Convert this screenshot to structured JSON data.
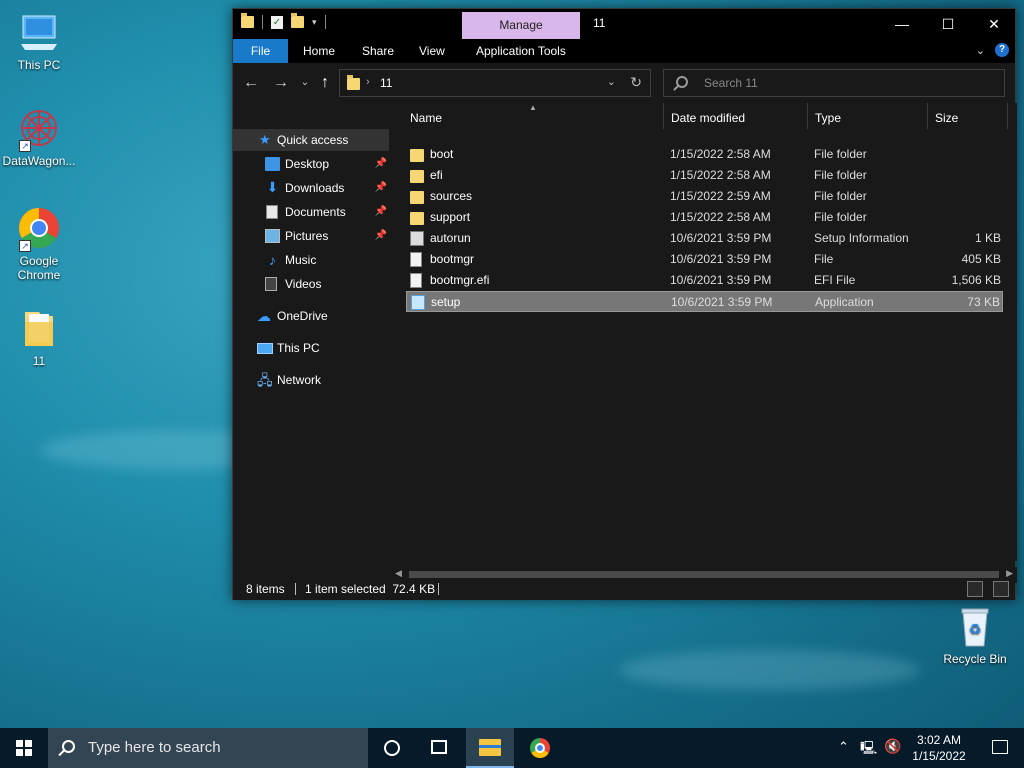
{
  "desktop": {
    "icons": [
      {
        "label": "This PC"
      },
      {
        "label": "DataWagon..."
      },
      {
        "label": "Google Chrome"
      },
      {
        "label": "11"
      }
    ],
    "recycle_bin": "Recycle Bin"
  },
  "window": {
    "title": "11",
    "manage_tab": "Manage",
    "ribbon_tabs": [
      "File",
      "Home",
      "Share",
      "View",
      "Application Tools"
    ],
    "address": {
      "path": "11"
    },
    "search": {
      "placeholder": "Search 11"
    },
    "nav_pane": [
      {
        "label": "Quick access",
        "icon": "star-icon"
      },
      {
        "label": "Desktop",
        "icon": "desktop-icon",
        "pinned": true
      },
      {
        "label": "Downloads",
        "icon": "download-icon",
        "pinned": true
      },
      {
        "label": "Documents",
        "icon": "document-icon",
        "pinned": true
      },
      {
        "label": "Pictures",
        "icon": "pictures-icon",
        "pinned": true
      },
      {
        "label": "Music",
        "icon": "music-icon"
      },
      {
        "label": "Videos",
        "icon": "videos-icon"
      },
      {
        "label": "OneDrive",
        "icon": "cloud-icon"
      },
      {
        "label": "This PC",
        "icon": "computer-icon"
      },
      {
        "label": "Network",
        "icon": "network-icon"
      }
    ],
    "columns": [
      "Name",
      "Date modified",
      "Type",
      "Size"
    ],
    "files": [
      {
        "name": "boot",
        "date": "1/15/2022 2:58 AM",
        "type": "File folder",
        "size": "",
        "kind": "folder"
      },
      {
        "name": "efi",
        "date": "1/15/2022 2:58 AM",
        "type": "File folder",
        "size": "",
        "kind": "folder"
      },
      {
        "name": "sources",
        "date": "1/15/2022 2:59 AM",
        "type": "File folder",
        "size": "",
        "kind": "folder"
      },
      {
        "name": "support",
        "date": "1/15/2022 2:58 AM",
        "type": "File folder",
        "size": "",
        "kind": "folder"
      },
      {
        "name": "autorun",
        "date": "10/6/2021 3:59 PM",
        "type": "Setup Information",
        "size": "1 KB",
        "kind": "inf"
      },
      {
        "name": "bootmgr",
        "date": "10/6/2021 3:59 PM",
        "type": "File",
        "size": "405 KB",
        "kind": "file"
      },
      {
        "name": "bootmgr.efi",
        "date": "10/6/2021 3:59 PM",
        "type": "EFI File",
        "size": "1,506 KB",
        "kind": "file"
      },
      {
        "name": "setup",
        "date": "10/6/2021 3:59 PM",
        "type": "Application",
        "size": "73 KB",
        "kind": "setup",
        "selected": true
      }
    ],
    "status": {
      "items": "8 items",
      "selection": "1 item selected  72.4 KB"
    }
  },
  "taskbar": {
    "search_placeholder": "Type here to search",
    "time": "3:02 AM",
    "date": "1/15/2022"
  }
}
